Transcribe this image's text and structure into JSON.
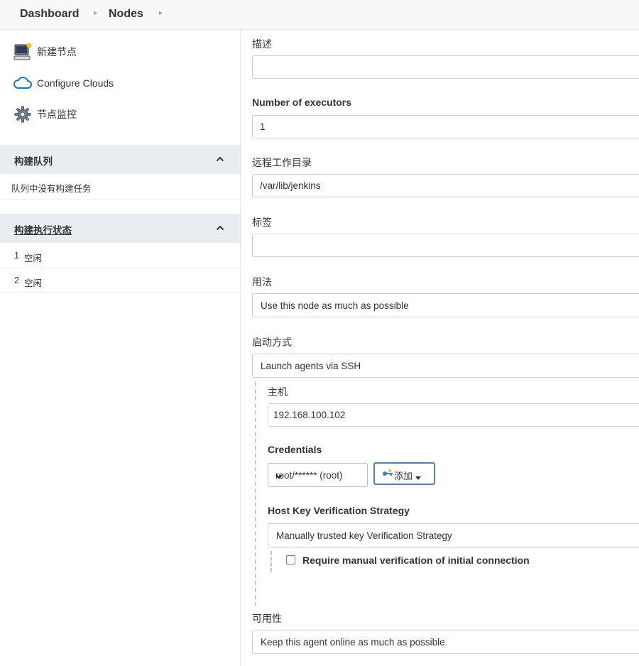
{
  "breadcrumb": {
    "items": [
      "Dashboard",
      "Nodes"
    ]
  },
  "sidebar": {
    "tasks": [
      {
        "label": "新建节点",
        "icon": "computer-icon"
      },
      {
        "label": "Configure Clouds",
        "icon": "cloud-icon"
      },
      {
        "label": "节点监控",
        "icon": "gear-icon"
      }
    ],
    "build_queue": {
      "title": "构建队列",
      "empty_text": "队列中没有构建任务"
    },
    "executor_status": {
      "title": "构建执行状态",
      "executors": [
        {
          "number": "1",
          "status": "空闲"
        },
        {
          "number": "2",
          "status": "空闲"
        }
      ]
    }
  },
  "form": {
    "description": {
      "label": "描述",
      "value": ""
    },
    "executors": {
      "label": "Number of executors",
      "value": "1"
    },
    "remote_dir": {
      "label": "远程工作目录",
      "value": "/var/lib/jenkins"
    },
    "labels": {
      "label": "标签",
      "value": ""
    },
    "usage": {
      "label": "用法",
      "value": "Use this node as much as possible"
    },
    "launch_method": {
      "label": "启动方式",
      "value": "Launch agents via SSH"
    },
    "host": {
      "label": "主机",
      "value": "192.168.100.102"
    },
    "credentials": {
      "label": "Credentials",
      "value": "root/****** (root)",
      "add_label": "添加"
    },
    "host_key_strategy": {
      "label": "Host Key Verification Strategy",
      "value": "Manually trusted key Verification Strategy",
      "require_manual_label": "Require manual verification of initial connection"
    },
    "availability": {
      "label": "可用性",
      "value": "Keep this agent online as much as possible"
    }
  },
  "colors": {
    "accent": "#5a7fa3",
    "pane_header_bg": "#e9edf0",
    "cloud_icon": "#1f6fb2"
  }
}
